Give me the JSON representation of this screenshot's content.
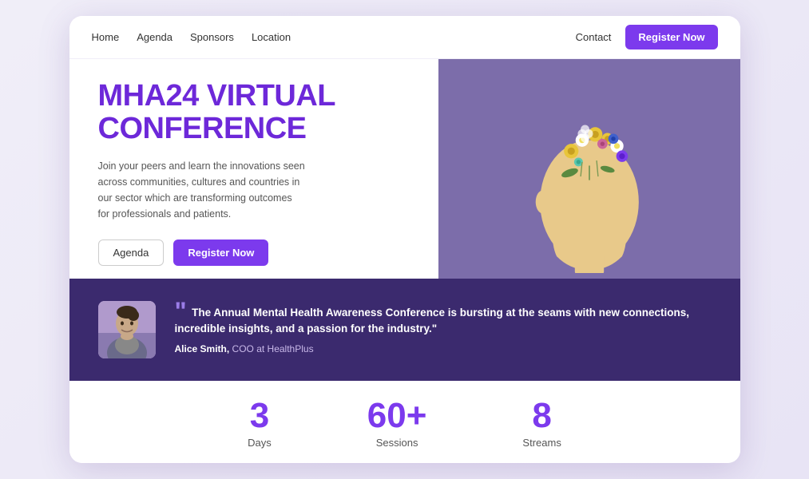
{
  "nav": {
    "links": [
      {
        "label": "Home",
        "id": "home"
      },
      {
        "label": "Agenda",
        "id": "agenda"
      },
      {
        "label": "Sponsors",
        "id": "sponsors"
      },
      {
        "label": "Location",
        "id": "location"
      }
    ],
    "contact": "Contact",
    "register_btn": "Register Now"
  },
  "hero": {
    "title": "MHA24 Virtual Conference",
    "description": "Join your peers and learn the innovations seen across communities, cultures and countries in our sector which are transforming outcomes for professionals and patients.",
    "btn_agenda": "Agenda",
    "btn_register": "Register Now"
  },
  "testimonial": {
    "quote": "The Annual Mental Health Awareness Conference is bursting at the seams with new connections, incredible insights, and a passion for the industry.\"",
    "author_name": "Alice Smith,",
    "author_role": "COO at HealthPlus"
  },
  "stats": [
    {
      "number": "3",
      "label": "Days"
    },
    {
      "number": "60+",
      "label": "Sessions"
    },
    {
      "number": "8",
      "label": "Streams"
    }
  ],
  "colors": {
    "primary": "#7c3aed",
    "dark_bg": "#3b2a6e",
    "hero_bg": "#7c6daa"
  }
}
